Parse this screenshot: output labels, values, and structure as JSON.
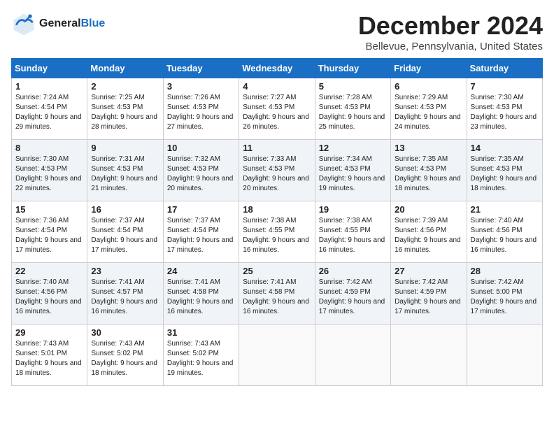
{
  "header": {
    "logo_line1": "General",
    "logo_line2": "Blue",
    "month": "December 2024",
    "location": "Bellevue, Pennsylvania, United States"
  },
  "weekdays": [
    "Sunday",
    "Monday",
    "Tuesday",
    "Wednesday",
    "Thursday",
    "Friday",
    "Saturday"
  ],
  "weeks": [
    [
      {
        "day": "1",
        "sunrise": "7:24 AM",
        "sunset": "4:54 PM",
        "daylight": "9 hours and 29 minutes."
      },
      {
        "day": "2",
        "sunrise": "7:25 AM",
        "sunset": "4:53 PM",
        "daylight": "9 hours and 28 minutes."
      },
      {
        "day": "3",
        "sunrise": "7:26 AM",
        "sunset": "4:53 PM",
        "daylight": "9 hours and 27 minutes."
      },
      {
        "day": "4",
        "sunrise": "7:27 AM",
        "sunset": "4:53 PM",
        "daylight": "9 hours and 26 minutes."
      },
      {
        "day": "5",
        "sunrise": "7:28 AM",
        "sunset": "4:53 PM",
        "daylight": "9 hours and 25 minutes."
      },
      {
        "day": "6",
        "sunrise": "7:29 AM",
        "sunset": "4:53 PM",
        "daylight": "9 hours and 24 minutes."
      },
      {
        "day": "7",
        "sunrise": "7:30 AM",
        "sunset": "4:53 PM",
        "daylight": "9 hours and 23 minutes."
      }
    ],
    [
      {
        "day": "8",
        "sunrise": "7:30 AM",
        "sunset": "4:53 PM",
        "daylight": "9 hours and 22 minutes."
      },
      {
        "day": "9",
        "sunrise": "7:31 AM",
        "sunset": "4:53 PM",
        "daylight": "9 hours and 21 minutes."
      },
      {
        "day": "10",
        "sunrise": "7:32 AM",
        "sunset": "4:53 PM",
        "daylight": "9 hours and 20 minutes."
      },
      {
        "day": "11",
        "sunrise": "7:33 AM",
        "sunset": "4:53 PM",
        "daylight": "9 hours and 20 minutes."
      },
      {
        "day": "12",
        "sunrise": "7:34 AM",
        "sunset": "4:53 PM",
        "daylight": "9 hours and 19 minutes."
      },
      {
        "day": "13",
        "sunrise": "7:35 AM",
        "sunset": "4:53 PM",
        "daylight": "9 hours and 18 minutes."
      },
      {
        "day": "14",
        "sunrise": "7:35 AM",
        "sunset": "4:53 PM",
        "daylight": "9 hours and 18 minutes."
      }
    ],
    [
      {
        "day": "15",
        "sunrise": "7:36 AM",
        "sunset": "4:54 PM",
        "daylight": "9 hours and 17 minutes."
      },
      {
        "day": "16",
        "sunrise": "7:37 AM",
        "sunset": "4:54 PM",
        "daylight": "9 hours and 17 minutes."
      },
      {
        "day": "17",
        "sunrise": "7:37 AM",
        "sunset": "4:54 PM",
        "daylight": "9 hours and 17 minutes."
      },
      {
        "day": "18",
        "sunrise": "7:38 AM",
        "sunset": "4:55 PM",
        "daylight": "9 hours and 16 minutes."
      },
      {
        "day": "19",
        "sunrise": "7:38 AM",
        "sunset": "4:55 PM",
        "daylight": "9 hours and 16 minutes."
      },
      {
        "day": "20",
        "sunrise": "7:39 AM",
        "sunset": "4:56 PM",
        "daylight": "9 hours and 16 minutes."
      },
      {
        "day": "21",
        "sunrise": "7:40 AM",
        "sunset": "4:56 PM",
        "daylight": "9 hours and 16 minutes."
      }
    ],
    [
      {
        "day": "22",
        "sunrise": "7:40 AM",
        "sunset": "4:56 PM",
        "daylight": "9 hours and 16 minutes."
      },
      {
        "day": "23",
        "sunrise": "7:41 AM",
        "sunset": "4:57 PM",
        "daylight": "9 hours and 16 minutes."
      },
      {
        "day": "24",
        "sunrise": "7:41 AM",
        "sunset": "4:58 PM",
        "daylight": "9 hours and 16 minutes."
      },
      {
        "day": "25",
        "sunrise": "7:41 AM",
        "sunset": "4:58 PM",
        "daylight": "9 hours and 16 minutes."
      },
      {
        "day": "26",
        "sunrise": "7:42 AM",
        "sunset": "4:59 PM",
        "daylight": "9 hours and 17 minutes."
      },
      {
        "day": "27",
        "sunrise": "7:42 AM",
        "sunset": "4:59 PM",
        "daylight": "9 hours and 17 minutes."
      },
      {
        "day": "28",
        "sunrise": "7:42 AM",
        "sunset": "5:00 PM",
        "daylight": "9 hours and 17 minutes."
      }
    ],
    [
      {
        "day": "29",
        "sunrise": "7:43 AM",
        "sunset": "5:01 PM",
        "daylight": "9 hours and 18 minutes."
      },
      {
        "day": "30",
        "sunrise": "7:43 AM",
        "sunset": "5:02 PM",
        "daylight": "9 hours and 18 minutes."
      },
      {
        "day": "31",
        "sunrise": "7:43 AM",
        "sunset": "5:02 PM",
        "daylight": "9 hours and 19 minutes."
      },
      null,
      null,
      null,
      null
    ]
  ]
}
